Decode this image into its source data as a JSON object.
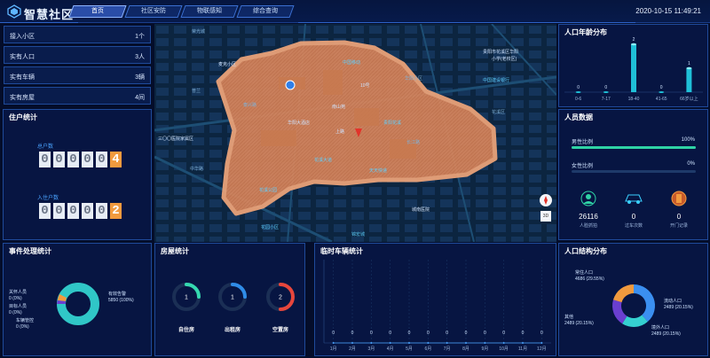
{
  "header": {
    "title": "智慧社区",
    "tabs": [
      "首页",
      "社区安防",
      "物联感知",
      "综合查询"
    ],
    "active_tab": 0,
    "datetime": "2020-10-15 11:49:21"
  },
  "summary": {
    "rows": [
      {
        "label": "接入小区",
        "value": "1个"
      },
      {
        "label": "实有人口",
        "value": "3人"
      },
      {
        "label": "实有车辆",
        "value": "3辆"
      },
      {
        "label": "实有房屋",
        "value": "4间"
      }
    ]
  },
  "households": {
    "title": "住户统计",
    "resident_label": "总户数",
    "resident_digits": [
      "0",
      "0",
      "0",
      "0",
      "0",
      "4"
    ],
    "checkin_label": "入住户数",
    "checkin_digits": [
      "0",
      "0",
      "0",
      "0",
      "0",
      "2"
    ]
  },
  "map": {
    "labels": [
      "荣光城",
      "麦克小区",
      "普兰",
      "泰兴路",
      "贵阳市花溪区华阳",
      "小学(老校区)",
      "中国移动",
      "三〇〇医院家属区",
      "华阳小区",
      "南山苑",
      "上路",
      "长江路",
      "贵阳花溪",
      "花溪大道",
      "花溪公园",
      "中国建设银行",
      "天天快递",
      "10号",
      "花溪区",
      "华阳大酒店",
      "花园小区",
      "城南医院",
      "中华路",
      "锦宏城"
    ],
    "accent": "#e08a5a"
  },
  "age_distribution": {
    "title": "人口年龄分布",
    "chart_data": {
      "type": "bar",
      "categories": [
        "0-6",
        "7-17",
        "18-40",
        "41-65",
        "66岁以上"
      ],
      "values": [
        0,
        0,
        2,
        0,
        1
      ],
      "title": "人口年龄分布",
      "ylim": [
        0,
        2
      ]
    }
  },
  "people_data": {
    "title": "人员数据",
    "male_label": "男性比例",
    "male_value": "100%",
    "male_fraction": 1.0,
    "female_label": "女性比例",
    "female_value": "0%",
    "female_fraction": 0.0,
    "metrics": [
      {
        "value": "26116",
        "label": "人脸抓拍",
        "icon": "face-icon"
      },
      {
        "value": "0",
        "label": "过车次数",
        "icon": "car-icon"
      },
      {
        "value": "0",
        "label": "开门记录",
        "icon": "door-icon"
      }
    ]
  },
  "events": {
    "title": "事件处理统计",
    "chart_data": {
      "type": "pie",
      "series": [
        {
          "name": "有效告警",
          "value": 5850,
          "percent": "100%",
          "color": "#30c7c7"
        },
        {
          "name": "关怀人员",
          "value": 0,
          "percent": "0%",
          "color": "#f19a3e"
        },
        {
          "name": "目标人员",
          "value": 0,
          "percent": "0%",
          "color": "#2f6fe0"
        },
        {
          "name": "车辆管控",
          "value": 0,
          "percent": "0%",
          "color": "#6a3fd0"
        }
      ]
    },
    "legend": [
      {
        "line1": "有效告警",
        "line2": "5850  (100%)"
      },
      {
        "line1": "关怀人员",
        "line2": "0  (0%)"
      },
      {
        "line1": "目标人员",
        "line2": "0  (0%)"
      },
      {
        "line1": "车辆管控",
        "line2": "0  (0%)"
      }
    ]
  },
  "housing": {
    "title": "房屋统计",
    "items": [
      {
        "value": "1",
        "label": "自住房",
        "color": "#35d8b0",
        "fraction": 0.25
      },
      {
        "value": "1",
        "label": "出租房",
        "color": "#2f8ce8",
        "fraction": 0.25
      },
      {
        "value": "2",
        "label": "空置房",
        "color": "#e8463c",
        "fraction": 0.5
      }
    ]
  },
  "temp_vehicles": {
    "title": "临时车辆统计",
    "chart_data": {
      "type": "line",
      "categories": [
        "1月",
        "2月",
        "3月",
        "4月",
        "5月",
        "6月",
        "7月",
        "8月",
        "9月",
        "10月",
        "11月",
        "12月"
      ],
      "values": [
        0,
        0,
        0,
        0,
        0,
        0,
        0,
        0,
        0,
        0,
        0,
        0
      ]
    }
  },
  "structure": {
    "title": "人口结构分布",
    "chart_data": {
      "type": "pie",
      "series": [
        {
          "name": "常住人口",
          "value": 4686,
          "percent": "29.55%",
          "color": "#3b8ff0"
        },
        {
          "name": "流动人口",
          "value": 2489,
          "percent": "20.15%",
          "color": "#35d0d0"
        },
        {
          "name": "境外人口",
          "value": 2489,
          "percent": "20.15%",
          "color": "#6a3fd0"
        },
        {
          "name": "其他",
          "value": 2489,
          "percent": "20.15%",
          "color": "#f19a3e"
        }
      ]
    },
    "legend": [
      {
        "line1": "常住人口",
        "line2": "4686  (29.55%)"
      },
      {
        "line1": "流动人口",
        "line2": "2489  (20.15%)"
      },
      {
        "line1": "境外人口",
        "line2": "2489  (20.15%)"
      },
      {
        "line1": "其他",
        "line2": "2489  (20.15%)"
      }
    ]
  }
}
